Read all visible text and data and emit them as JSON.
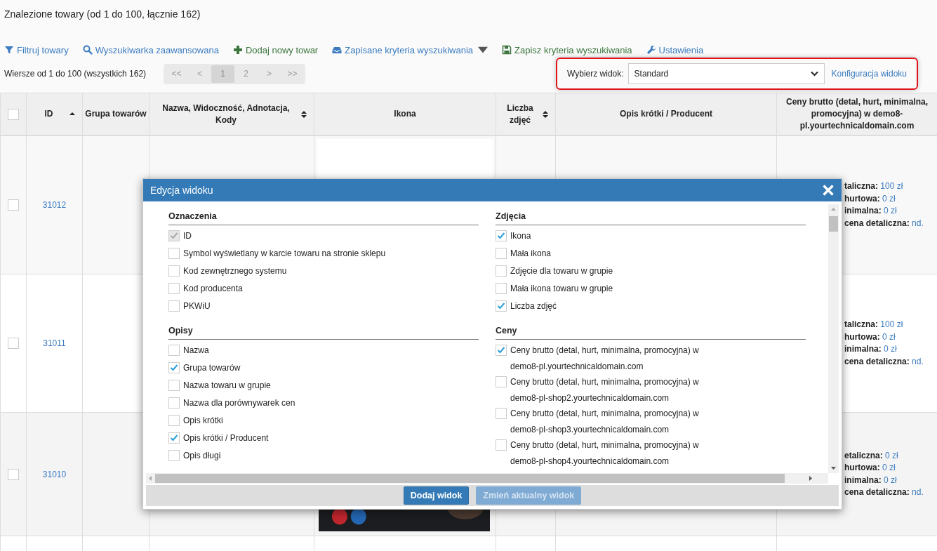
{
  "header": {
    "title": "Znalezione towary (od 1 do 100, łącznie 162)"
  },
  "toolbar": [
    {
      "kind": "filter",
      "label": "Filtruj towary"
    },
    {
      "kind": "search",
      "label": "Wyszukiwarka zaawansowana"
    },
    {
      "kind": "add",
      "label": "Dodaj nowy towar"
    },
    {
      "kind": "saved",
      "label": "Zapisane kryteria wyszukiwania",
      "dropdown": true
    },
    {
      "kind": "save",
      "label": "Zapisz kryteria wyszukiwania"
    },
    {
      "kind": "settings",
      "label": "Ustawienia"
    }
  ],
  "rows_info": "Wiersze od 1 do 100 (wszystkich 162)",
  "pagination": [
    {
      "label": "<<",
      "selected": false
    },
    {
      "label": "<",
      "selected": false
    },
    {
      "label": "1",
      "selected": true
    },
    {
      "label": "2",
      "selected": false
    },
    {
      "label": ">",
      "selected": false
    },
    {
      "label": ">>",
      "selected": false
    }
  ],
  "view_selector": {
    "label": "Wybierz widok:",
    "value": "Standard",
    "link": "Konfiguracja widoku"
  },
  "table": {
    "select_all": {
      "checked": false
    },
    "columns": [
      {
        "label": "ID",
        "sortable": true,
        "sorted": true
      },
      {
        "label": "Grupa towarów",
        "sortable": false
      },
      {
        "label": "Nazwa, Widoczność, Adnotacja, Kody",
        "sortable": true,
        "sorted": false
      },
      {
        "label": "Ikona",
        "sortable": false
      },
      {
        "label": "Liczba zdjęć",
        "sortable": true,
        "sorted": false
      },
      {
        "label": "Opis krótki / Producent",
        "sortable": false
      },
      {
        "label": "Ceny brutto (detal, hurt, minimalna, promocyjna) w demo8-pl.yourtechnicaldomain.com",
        "sortable": false
      }
    ],
    "rows": [
      {
        "checked": false,
        "id": "31012",
        "kind": "blank",
        "prices": [
          {
            "label": "taliczna:",
            "value": "100 zł"
          },
          {
            "label": "hurtowa:",
            "value": "0 zł"
          },
          {
            "label": "inimalna:",
            "value": "0 zł"
          },
          {
            "label": "cena detaliczna:",
            "value": "nd."
          }
        ]
      },
      {
        "checked": false,
        "id": "31011",
        "kind": "empty",
        "prices": [
          {
            "label": "taliczna:",
            "value": "100 zł"
          },
          {
            "label": "hurtowa:",
            "value": "0 zł"
          },
          {
            "label": "inimalna:",
            "value": "0 zł"
          },
          {
            "label": "cena detaliczna:",
            "value": "nd."
          }
        ]
      },
      {
        "checked": false,
        "id": "31010",
        "kind": "picture",
        "prices": [
          {
            "label": "etaliczna:",
            "value": "0 zł"
          },
          {
            "label": "hurtowa:",
            "value": "0 zł"
          },
          {
            "label": "inimalna:",
            "value": "0 zł"
          },
          {
            "label": "cena detaliczna:",
            "value": "nd."
          }
        ]
      }
    ]
  },
  "dialog": {
    "title": "Edycja widoku",
    "columns": [
      [
        {
          "title": "Oznaczenia",
          "options": [
            {
              "label": "ID",
              "checked": true,
              "disabled": true
            },
            {
              "label": "Symbol wyświetlany w karcie towaru na stronie sklepu",
              "checked": false,
              "disabled": false
            },
            {
              "label": "Kod zewnętrznego systemu",
              "checked": false,
              "disabled": false
            },
            {
              "label": "Kod producenta",
              "checked": false,
              "disabled": false
            },
            {
              "label": "PKWiU",
              "checked": false,
              "disabled": false
            }
          ]
        },
        {
          "title": "Opisy",
          "options": [
            {
              "label": "Nazwa",
              "checked": false,
              "disabled": false
            },
            {
              "label": "Grupa towarów",
              "checked": true,
              "disabled": false
            },
            {
              "label": "Nazwa towaru w grupie",
              "checked": false,
              "disabled": false
            },
            {
              "label": "Nazwa dla porównywarek cen",
              "checked": false,
              "disabled": false
            },
            {
              "label": "Opis krótki",
              "checked": false,
              "disabled": false
            },
            {
              "label": "Opis krótki / Producent",
              "checked": true,
              "disabled": false
            },
            {
              "label": "Opis długi",
              "checked": false,
              "disabled": false
            }
          ]
        }
      ],
      [
        {
          "title": "Zdjęcia",
          "options": [
            {
              "label": "Ikona",
              "checked": true,
              "disabled": false
            },
            {
              "label": "Mała ikona",
              "checked": false,
              "disabled": false
            },
            {
              "label": "Zdjęcie dla towaru w grupie",
              "checked": false,
              "disabled": false
            },
            {
              "label": "Mała ikona towaru w grupie",
              "checked": false,
              "disabled": false
            },
            {
              "label": "Liczba zdjęć",
              "checked": true,
              "disabled": false
            }
          ]
        },
        {
          "title": "Ceny",
          "options": [
            {
              "label": "Ceny brutto (detal, hurt, minimalna, promocyjna) w demo8-pl.yourtechnicaldomain.com",
              "checked": true,
              "disabled": false
            },
            {
              "label": "Ceny brutto (detal, hurt, minimalna, promocyjna) w demo8-pl-shop2.yourtechnicaldomain.com",
              "checked": false,
              "disabled": false
            },
            {
              "label": "Ceny brutto (detal, hurt, minimalna, promocyjna) w demo8-pl-shop3.yourtechnicaldomain.com",
              "checked": false,
              "disabled": false
            },
            {
              "label": "Ceny brutto (detal, hurt, minimalna, promocyjna) w demo8-pl-shop4.yourtechnicaldomain.com",
              "checked": false,
              "disabled": false
            }
          ]
        }
      ]
    ],
    "buttons": [
      {
        "label": "Dodaj widok",
        "disabled": false
      },
      {
        "label": "Zmień aktualny widok",
        "disabled": true
      }
    ]
  }
}
